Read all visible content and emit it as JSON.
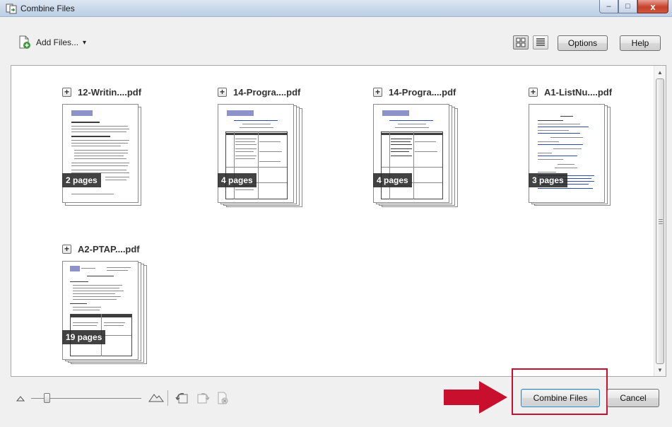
{
  "window": {
    "title": "Combine Files",
    "minimize_label": "–",
    "maximize_label": "□",
    "close_label": "x"
  },
  "toolbar": {
    "add_files_label": "Add Files...",
    "add_files_caret": "▾",
    "options_label": "Options",
    "help_label": "Help"
  },
  "files": [
    {
      "name": "12-Writin....pdf",
      "pages_label": "2 pages"
    },
    {
      "name": "14-Progra....pdf",
      "pages_label": "4 pages"
    },
    {
      "name": "14-Progra....pdf",
      "pages_label": "4 pages"
    },
    {
      "name": "A1-ListNu....pdf",
      "pages_label": "3 pages"
    },
    {
      "name": "A2-PTAP....pdf",
      "pages_label": "19 pages"
    }
  ],
  "footer": {
    "combine_label": "Combine Files",
    "cancel_label": "Cancel"
  },
  "colors": {
    "highlight": "#c8102e",
    "badge": "#282828"
  }
}
